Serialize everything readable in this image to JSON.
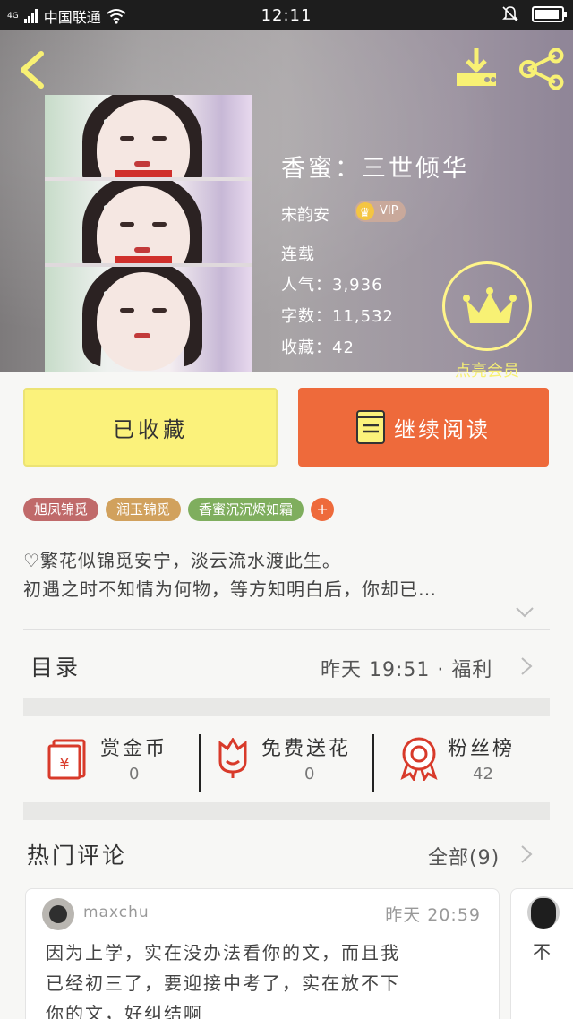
{
  "status_bar": {
    "network_tag": "4G",
    "carrier": "中国联通",
    "time": "12:11"
  },
  "book": {
    "title": "香蜜：三世倾华",
    "author": "宋韵安",
    "vip_label": "VIP",
    "status": "连载",
    "popularity": "人气：3,936",
    "word_count": "字数：11,532",
    "favorites": "收藏：42",
    "member_label": "点亮会员"
  },
  "actions": {
    "collected_label": "已收藏",
    "continue_label": "继续阅读"
  },
  "tags": [
    {
      "label": "旭凤锦觅",
      "color": "#c06a6a"
    },
    {
      "label": "润玉锦觅",
      "color": "#d1a15d"
    },
    {
      "label": "香蜜沉沉烬如霜",
      "color": "#7fae5e"
    }
  ],
  "tag_add_label": "+",
  "summary": {
    "line1": "♡繁花似锦觅安宁，淡云流水渡此生。",
    "line2": "初遇之时不知情为何物，等方知明白后，你却已…"
  },
  "catalog": {
    "title": "目录",
    "latest": "昨天 19:51 · 福利"
  },
  "stats": [
    {
      "label": "赏金币",
      "value": "0"
    },
    {
      "label": "免费送花",
      "value": "0"
    },
    {
      "label": "粉丝榜",
      "value": "42"
    }
  ],
  "comments": {
    "title": "热门评论",
    "all_label": "全部(9)",
    "items": [
      {
        "user": "maxchu",
        "time": "昨天 20:59",
        "line1": "因为上学，实在没办法看你的文，而且我",
        "line2": "已经初三了，要迎接中考了，实在放不下",
        "line3": "你的文，好纠结啊"
      },
      {
        "line1": "不"
      }
    ]
  },
  "colors": {
    "accent_orange": "#ee6a3b",
    "collected_yellow": "#fbf27b",
    "member_yellow": "#f8f174"
  }
}
